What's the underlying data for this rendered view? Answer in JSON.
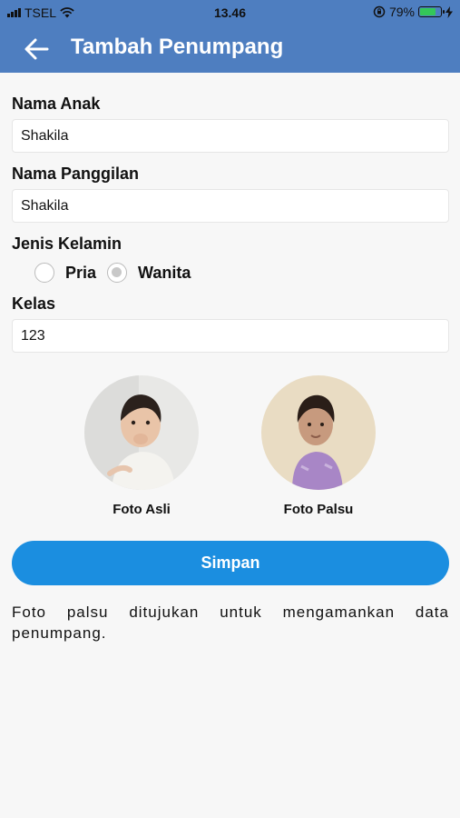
{
  "status_bar": {
    "carrier": "TSEL",
    "time": "13.46",
    "battery": "79%",
    "battery_level": 0.79
  },
  "header": {
    "title": "Tambah Penumpang"
  },
  "form": {
    "child_name": {
      "label": "Nama Anak",
      "value": "Shakila"
    },
    "nickname": {
      "label": "Nama Panggilan",
      "value": "Shakila"
    },
    "gender": {
      "label": "Jenis Kelamin",
      "options": [
        "Pria",
        "Wanita"
      ],
      "selected": "Wanita"
    },
    "class": {
      "label": "Kelas",
      "value": "123"
    }
  },
  "photos": {
    "real_label": "Foto Asli",
    "fake_label": "Foto Palsu"
  },
  "save_button": "Simpan",
  "note": "Foto palsu ditujukan untuk mengamankan data penumpang."
}
